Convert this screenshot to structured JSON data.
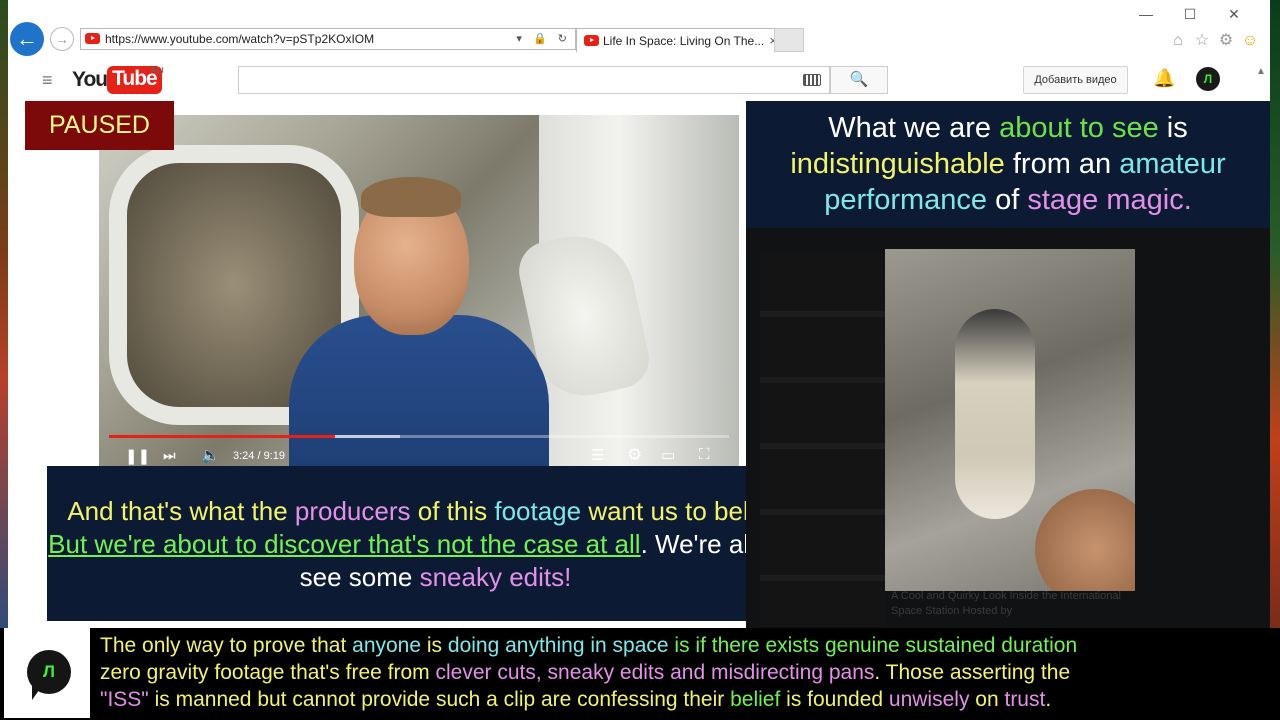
{
  "browser": {
    "url": "https://www.youtube.com/watch?v=pSTp2KOxIOM",
    "tab_title": "Life In Space: Living On The...",
    "tab_close": "×",
    "window_controls": [
      "—",
      "☐",
      "✕"
    ]
  },
  "youtube": {
    "logo_you": "You",
    "logo_tube": "Tube",
    "region": "AU",
    "search_placeholder": "",
    "upload_button": "Добавить видео",
    "avatar_letter": "Л"
  },
  "player": {
    "state_badge": "PAUSED",
    "time": "3:24 / 9:19",
    "progress_fraction": 0.365,
    "buffer_fraction": 0.47
  },
  "overlay_left": {
    "p1": "And that's what the ",
    "p2": "producers",
    "p3": " of this ",
    "p4": "footage",
    "p5": " want us to believe. ",
    "p6": "But we're about to discover that's not the case at all",
    "p7": ". We're about to see some ",
    "p8": "sneaky edits!"
  },
  "headline": {
    "h1": "What we are ",
    "h2": "about to see",
    "h3": " is ",
    "h4": "indistinguishable",
    "h5": " from an ",
    "h6": "amateur",
    "h7": "performance",
    "h8": " of ",
    "h9": "stage magic."
  },
  "right_caption": "A Cool and Quirky Look Inside the International Space Station Hosted by",
  "bottom_bar": {
    "logo_letter": "Л",
    "b1": "The only way to prove that ",
    "b2": "anyone",
    "b3": " is ",
    "b4": "doing anything in space",
    "b5": " is ",
    "b6": "if there exists genuine sustained duration",
    "b7": "zero gravity footage that's free from ",
    "b8": "clever cuts, sneaky edits and misdirecting pans",
    "b9": ". Those asserting the ",
    "b10": "\"ISS\"",
    "b11": " is manned but cannot provide such a clip are confessing their ",
    "b12": "belief",
    "b13": " is founded ",
    "b14": "unwisely",
    "b15": " on ",
    "b16": "trust",
    "b17": "."
  },
  "colors": {
    "yellow_text": "#f2f26b",
    "pink_text": "#e290e8",
    "cyan_text": "#7ee8e8",
    "green_text": "#72f252",
    "panel_bg": "#0c1b33",
    "badge_bg": "#7d0a0a",
    "youtube_red": "#e62117"
  }
}
